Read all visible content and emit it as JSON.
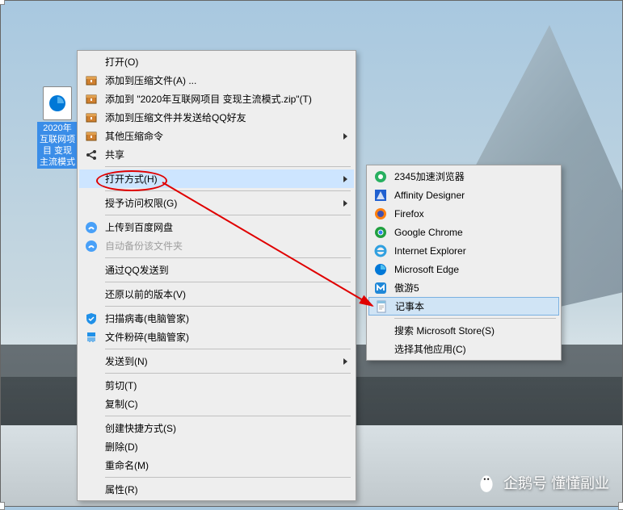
{
  "desktop_icon": {
    "label": "2020年互联网项目 变现主流模式"
  },
  "main_menu": [
    {
      "label": "打开(O)",
      "icon": null,
      "sep_after": false
    },
    {
      "label": "添加到压缩文件(A) ...",
      "icon": "archive",
      "sep_after": false
    },
    {
      "label": "添加到 \"2020年互联网项目 变现主流模式.zip\"(T)",
      "icon": "archive",
      "sep_after": false
    },
    {
      "label": "添加到压缩文件并发送给QQ好友",
      "icon": "archive",
      "sep_after": false
    },
    {
      "label": "其他压缩命令",
      "icon": "archive",
      "submenu": true,
      "sep_after": false
    },
    {
      "label": "共享",
      "icon": "share",
      "sep_after": true
    },
    {
      "label": "打开方式(H)",
      "icon": null,
      "submenu": true,
      "highlight": true,
      "sep_after": true
    },
    {
      "label": "授予访问权限(G)",
      "icon": null,
      "submenu": true,
      "sep_after": true
    },
    {
      "label": "上传到百度网盘",
      "icon": "baidu",
      "sep_after": false
    },
    {
      "label": "自动备份该文件夹",
      "icon": "baidu",
      "disabled": true,
      "sep_after": true
    },
    {
      "label": "通过QQ发送到",
      "icon": null,
      "sep_after": true
    },
    {
      "label": "还原以前的版本(V)",
      "icon": null,
      "sep_after": true
    },
    {
      "label": "扫描病毒(电脑管家)",
      "icon": "shield",
      "sep_after": false
    },
    {
      "label": "文件粉碎(电脑管家)",
      "icon": "shred",
      "sep_after": true
    },
    {
      "label": "发送到(N)",
      "icon": null,
      "submenu": true,
      "sep_after": true
    },
    {
      "label": "剪切(T)",
      "icon": null,
      "sep_after": false
    },
    {
      "label": "复制(C)",
      "icon": null,
      "sep_after": true
    },
    {
      "label": "创建快捷方式(S)",
      "icon": null,
      "sep_after": false
    },
    {
      "label": "删除(D)",
      "icon": null,
      "sep_after": false
    },
    {
      "label": "重命名(M)",
      "icon": null,
      "sep_after": true
    },
    {
      "label": "属性(R)",
      "icon": null,
      "sep_after": false
    }
  ],
  "sub_menu": [
    {
      "label": "2345加速浏览器",
      "icon": "b2345"
    },
    {
      "label": "Affinity Designer",
      "icon": "affinity"
    },
    {
      "label": "Firefox",
      "icon": "firefox"
    },
    {
      "label": "Google Chrome",
      "icon": "chrome"
    },
    {
      "label": "Internet Explorer",
      "icon": "ie"
    },
    {
      "label": "Microsoft Edge",
      "icon": "edge"
    },
    {
      "label": "傲游5",
      "icon": "maxthon"
    },
    {
      "label": "记事本",
      "icon": "notepad",
      "selected": true,
      "sep_after": true
    },
    {
      "label": "搜索 Microsoft Store(S)",
      "icon": null
    },
    {
      "label": "选择其他应用(C)",
      "icon": null
    }
  ],
  "watermark": "企鹅号 懂懂副业"
}
